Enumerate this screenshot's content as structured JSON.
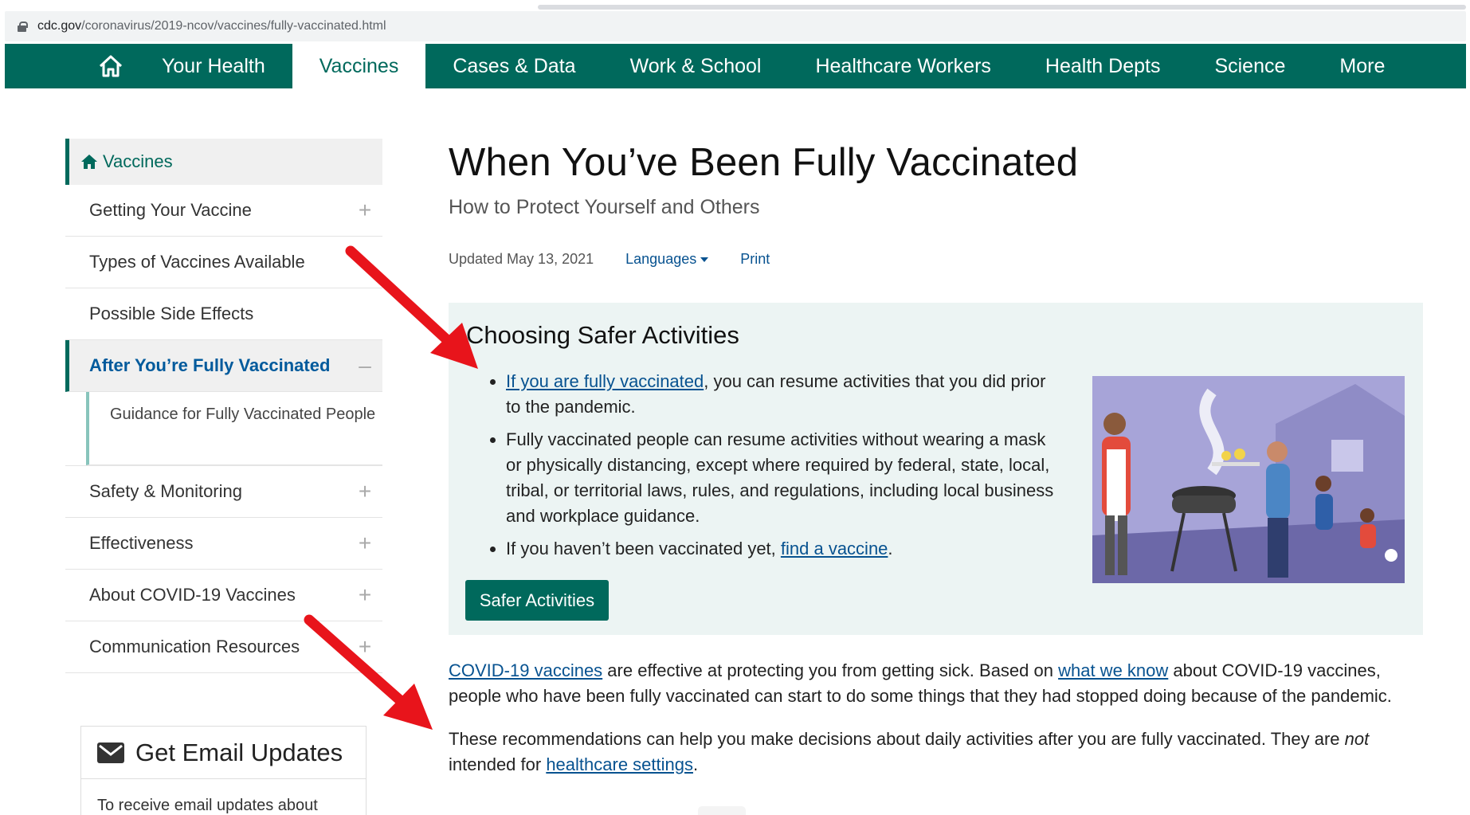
{
  "browser": {
    "url_host": "cdc.gov",
    "url_path": "/coronavirus/2019-ncov/vaccines/fully-vaccinated.html"
  },
  "topnav": {
    "home_icon": "home-icon",
    "items": [
      "Your Health",
      "Vaccines",
      "Cases & Data",
      "Work & School",
      "Healthcare Workers",
      "Health Depts",
      "Science",
      "More"
    ],
    "active": "Vaccines"
  },
  "sidebar": {
    "header": "Vaccines",
    "items": [
      {
        "label": "Getting Your Vaccine",
        "toggle": "+"
      },
      {
        "label": "Types of Vaccines Available",
        "toggle": ""
      },
      {
        "label": "Possible Side Effects",
        "toggle": ""
      },
      {
        "label": "After You’re Fully Vaccinated",
        "toggle": "–"
      },
      {
        "label": "Safety & Monitoring",
        "toggle": "+"
      },
      {
        "label": "Effectiveness",
        "toggle": "+"
      },
      {
        "label": "About COVID-19 Vaccines",
        "toggle": "+"
      },
      {
        "label": "Communication Resources",
        "toggle": "+"
      }
    ],
    "subitem": "Guidance for Fully Vaccinated People",
    "email_title": "Get Email Updates",
    "email_text": "To receive email updates about"
  },
  "main": {
    "title": "When You’ve Been Fully Vaccinated",
    "subtitle": "How to Protect Yourself and Others",
    "updated": "Updated May 13, 2021",
    "languages": "Languages",
    "print": "Print",
    "callout": {
      "heading": "Choosing Safer Activities",
      "b1_link": "If you are fully vaccinated",
      "b1_rest": ", you can resume activities that you did prior to the pandemic.",
      "b2": "Fully vaccinated people can resume activities without wearing a mask or physically distancing, except where required by federal, state, local, tribal, or territorial laws, rules, and regulations, including local business and workplace guidance.",
      "b3_pre": "If you haven’t been vaccinated yet, ",
      "b3_link": "find a vaccine",
      "b3_post": ".",
      "button": "Safer Activities"
    },
    "p1_link1": "COVID-19 vaccines",
    "p1_mid": " are effective at protecting you from getting sick. Based on ",
    "p1_link2": "what we know",
    "p1_rest": " about COVID-19 vaccines, people who have been fully vaccinated can start to do some things that they had stopped doing because of the pandemic.",
    "p2_pre": "These recommendations can help you make decisions about daily activities after you are fully vaccinated. They are ",
    "p2_em": "not",
    "p2_mid": " intended for ",
    "p2_link": "healthcare settings",
    "p2_post": "."
  },
  "colors": {
    "brand": "#00695c",
    "link": "#075290",
    "callout_bg": "#ecf4f3",
    "arrow": "#e8141b"
  }
}
